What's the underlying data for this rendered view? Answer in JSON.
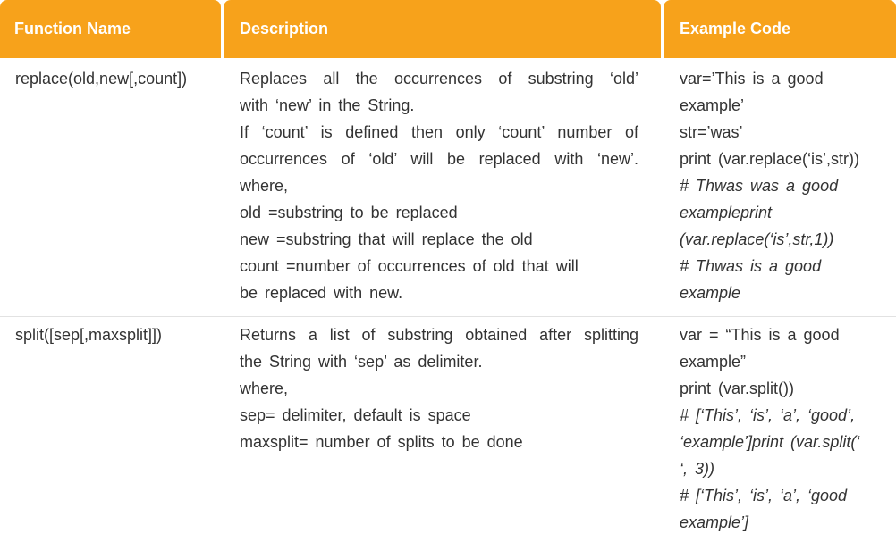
{
  "header": {
    "col1": "Function Name",
    "col2": "Description",
    "col3": "Example Code"
  },
  "rows": [
    {
      "name": "replace(old,new[,count])",
      "description": [
        "Replaces all the occurrences of substring ‘old’",
        "with ‘new’ in the String.",
        "If ‘count’ is defined then only ‘count’ number of",
        "occurrences of ‘old’ will be replaced with ‘new’.",
        "where,",
        "old =substring to be replaced",
        "new =substring that will replace the old",
        "count =number of occurrences of old that will",
        "be replaced with new."
      ],
      "example": [
        "var=’This is a good",
        "example’",
        "str=’was’",
        "print (var.replace(‘is’,str))",
        "# Thwas was a good",
        "exampleprint",
        "(var.replace(‘is’,str,1))",
        "# Thwas is a good",
        "example"
      ]
    },
    {
      "name": "split([sep[,maxsplit]])",
      "description": [
        "Returns a list of substring obtained after splitting",
        "the String with ‘sep’ as delimiter.",
        "where,",
        "sep= delimiter, default is space",
        "maxsplit= number of splits to be done"
      ],
      "example": [
        "var = “This is a good",
        "example”",
        "print (var.split())",
        "# [‘This’, ‘is’, ‘a’, ‘good’,",
        "‘example’]print (var.split(‘",
        "‘, 3))",
        "# [‘This’, ‘is’, ‘a’, ‘good",
        "example’]"
      ]
    }
  ]
}
